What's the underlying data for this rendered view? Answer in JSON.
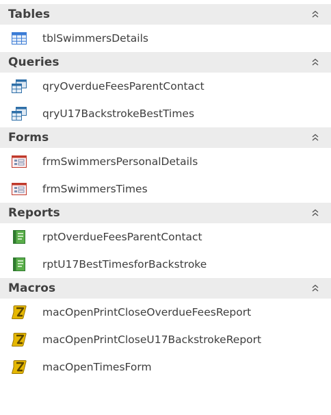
{
  "groups": [
    {
      "title": "Tables",
      "icon": "table-icon",
      "items": [
        "tblSwimmersDetails"
      ]
    },
    {
      "title": "Queries",
      "icon": "query-icon",
      "items": [
        "qryOverdueFeesParentContact",
        "qryU17BackstrokeBestTimes"
      ]
    },
    {
      "title": "Forms",
      "icon": "form-icon",
      "items": [
        "frmSwimmersPersonalDetails",
        "frmSwimmersTimes"
      ]
    },
    {
      "title": "Reports",
      "icon": "report-icon",
      "items": [
        "rptOverdueFeesParentContact",
        "rptU17BestTimesforBackstroke"
      ]
    },
    {
      "title": "Macros",
      "icon": "macro-icon",
      "items": [
        "macOpenPrintCloseOverdueFeesReport",
        "macOpenPrintCloseU17BackstrokeReport",
        "macOpenTimesForm"
      ]
    }
  ],
  "colors": {
    "header_bg": "#ececec",
    "table_icon": "#3a7bd5",
    "query_icon": "#2e6fa8",
    "form_icon": "#c0392b",
    "report_icon": "#3c9a3c",
    "macro_icon": "#d4a400"
  }
}
